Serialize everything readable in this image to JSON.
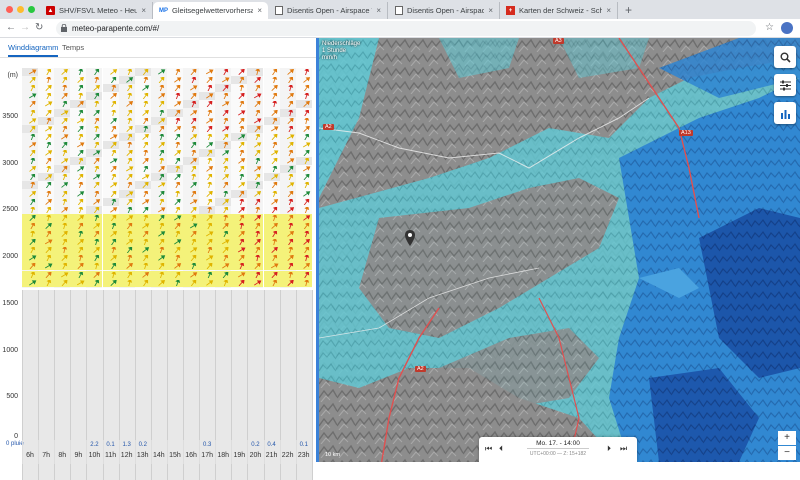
{
  "browser": {
    "tabs": [
      {
        "title": "SHV/FSVL Meteo - Heute",
        "favicon": "shv-logo",
        "active": false
      },
      {
        "title": "Gleitsegelwettervorhersage | M",
        "favicon": "MP",
        "active": true
      },
      {
        "title": "Disentis Open - Airspace Wildl",
        "favicon": "page-icon",
        "active": false
      },
      {
        "title": "Disentis Open - Airspace",
        "favicon": "page-icon",
        "active": false
      },
      {
        "title": "Karten der Schweiz - Schweizer",
        "favicon": "swiss-flag",
        "active": false
      }
    ],
    "new_tab_label": "+",
    "url": "meteo-parapente.com/#/"
  },
  "panel": {
    "tabs": [
      "Winddiagramm",
      "Temps"
    ],
    "unit_label": "(m)",
    "y_ticks": [
      "3500",
      "3000",
      "2500",
      "2000",
      "1500",
      "1000",
      "500",
      "0"
    ],
    "plui_label": "0 pluie",
    "hours": [
      "6h",
      "7h",
      "8h",
      "9h",
      "10h",
      "11h",
      "12h",
      "13h",
      "14h",
      "15h",
      "16h",
      "17h",
      "18h",
      "19h",
      "20h",
      "21h",
      "22h",
      "23h"
    ],
    "rain": [
      "",
      "",
      "",
      "",
      "2.2",
      "0.1",
      "1.3",
      "0.2",
      "",
      "",
      "",
      "0.3",
      "",
      "",
      "0.2",
      "0.4",
      "",
      "0.1"
    ],
    "rain_sub": [
      "",
      "",
      "",
      "",
      "",
      "",
      "",
      "",
      "",
      "",
      "",
      "",
      "",
      "",
      "",
      "",
      "",
      ""
    ],
    "rain_color": "#2255aa",
    "wind_colors": {
      "calm": "#1e8a3a",
      "moderate": "#e0b400",
      "strong": "#e07a10",
      "very_strong": "#d62020"
    }
  },
  "map": {
    "legend_line1": "Niederschläge",
    "legend_line2": "1 Stunde",
    "legend_line3": "mm/h",
    "player_time": "Mo. 17. - 14:00",
    "player_sub": "UTC+00:00 — Z: 15+182",
    "roads": [
      "A2",
      "A13",
      "A3",
      "A13",
      "A2"
    ],
    "scale": "10 km",
    "zoom_in": "+",
    "zoom_out": "−",
    "colors": {
      "rain_light": "#6fd0d8",
      "rain_mid": "#2e8ad6",
      "rain_heavy": "#1a4fa8",
      "terrain": "#8a8a8a"
    }
  }
}
